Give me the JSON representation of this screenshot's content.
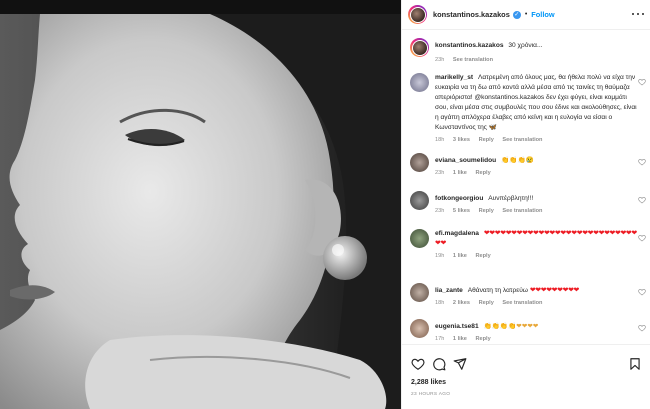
{
  "post": {
    "username": "konstantinos.kazakos",
    "dot": "•",
    "follow_label": "Follow",
    "caption_text": "30 χρόνια...",
    "caption_time": "23h",
    "caption_translation": "See translation"
  },
  "comments": [
    {
      "username": "marikelly_st",
      "text": "Λατρεμένη από όλους μας, θα ήθελα πολύ να είχα την ευκαιρία να τη δω από κοντά αλλά μέσα από τις ταινίες τη θαύμαζα απεριόριστα! @konstantinos.kazakos δεν έχει φύγει, είναι κομμάτι σου, είναι μέσα στις συμβουλές που σου έδινε και ακολούθησες, είναι η αγάπη απλόχερα έλαβες από κείνη και η ευλογία να είσαι ο Κωνσταντίνος της",
      "emoji": "🦋",
      "time": "18h",
      "likes": "3 likes",
      "reply": "Reply",
      "translation": "See translation"
    },
    {
      "username": "eviana_soumelidou",
      "text": "",
      "emoji": "👏👏👏😢",
      "time": "23h",
      "likes": "1 like",
      "reply": "Reply",
      "translation": ""
    },
    {
      "username": "fotkongeorgiou",
      "text": "Αυνπέρβλητη!!!",
      "emoji": "",
      "time": "23h",
      "likes": "5 likes",
      "reply": "Reply",
      "translation": "See translation"
    },
    {
      "username": "efi.magdalena",
      "text": "",
      "emoji": "❤❤❤❤❤❤❤❤❤❤❤❤❤❤❤❤❤❤❤❤❤❤❤❤❤❤❤❤❤❤",
      "time": "19h",
      "likes": "1 like",
      "reply": "Reply",
      "translation": ""
    },
    {
      "username": "lia_zante",
      "text": "Αθάνατη τη λατρεύω",
      "emoji": "❤❤❤❤❤❤❤❤❤",
      "time": "18h",
      "likes": "2 likes",
      "reply": "Reply",
      "translation": "See translation"
    },
    {
      "username": "eugenia.tse81",
      "text": "",
      "emoji": "👏👏👏👏❤❤❤❤",
      "time": "17h",
      "likes": "1 like",
      "reply": "Reply",
      "translation": ""
    }
  ],
  "footer": {
    "likes_count": "2,288 likes",
    "posted_time": "23 HOURS AGO"
  },
  "icons": {
    "like": "heart-icon",
    "comment": "comment-icon",
    "share": "share-icon",
    "save": "bookmark-icon",
    "more": "more-icon"
  },
  "colors": {
    "accent": "#0095f6",
    "verified": "#3897f0",
    "muted": "#8e8e8e",
    "heart": "#ed1c24"
  }
}
